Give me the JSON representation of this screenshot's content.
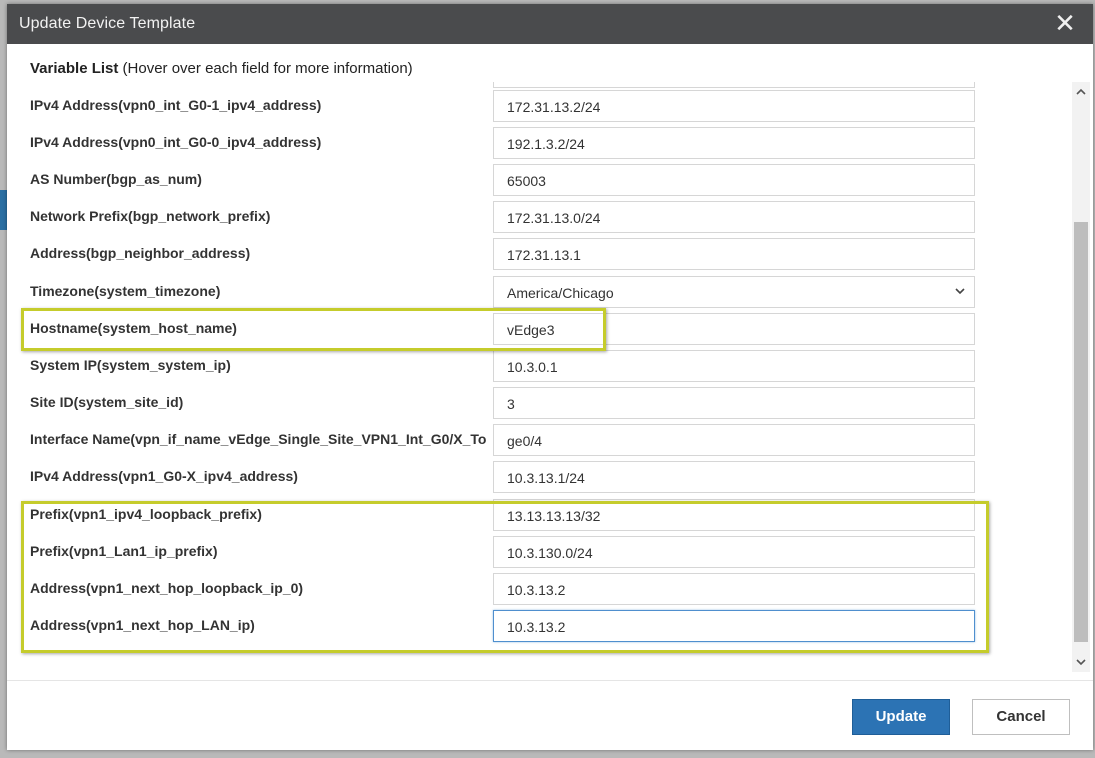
{
  "dialog": {
    "title": "Update Device Template",
    "close_glyph": "✕",
    "header_bold": "Variable List",
    "header_hint": " (Hover over each field for more information)"
  },
  "rows": [
    {
      "label": "IPv4 Address(vpn0_int_G0-1_ipv4_address)",
      "value": "172.31.13.2/24",
      "type": "text"
    },
    {
      "label": "IPv4 Address(vpn0_int_G0-0_ipv4_address)",
      "value": "192.1.3.2/24",
      "type": "text"
    },
    {
      "label": "AS Number(bgp_as_num)",
      "value": "65003",
      "type": "text"
    },
    {
      "label": "Network Prefix(bgp_network_prefix)",
      "value": "172.31.13.0/24",
      "type": "text"
    },
    {
      "label": "Address(bgp_neighbor_address)",
      "value": "172.31.13.1",
      "type": "text"
    },
    {
      "label": "Timezone(system_timezone)",
      "value": "America/Chicago",
      "type": "select"
    },
    {
      "label": "Hostname(system_host_name)",
      "value": "vEdge3",
      "type": "text"
    },
    {
      "label": "System IP(system_system_ip)",
      "value": "10.3.0.1",
      "type": "text"
    },
    {
      "label": "Site ID(system_site_id)",
      "value": "3",
      "type": "text"
    },
    {
      "label": "Interface Name(vpn_if_name_vEdge_Single_Site_VPN1_Int_G0/X_To",
      "value": "ge0/4",
      "type": "text"
    },
    {
      "label": "IPv4 Address(vpn1_G0-X_ipv4_address)",
      "value": "10.3.13.1/24",
      "type": "text"
    },
    {
      "label": "Prefix(vpn1_ipv4_loopback_prefix)",
      "value": "13.13.13.13/32",
      "type": "text"
    },
    {
      "label": "Prefix(vpn1_Lan1_ip_prefix)",
      "value": "10.3.130.0/24",
      "type": "text"
    },
    {
      "label": "Address(vpn1_next_hop_loopback_ip_0)",
      "value": "10.3.13.2",
      "type": "text"
    },
    {
      "label": "Address(vpn1_next_hop_LAN_ip)",
      "value": "10.3.13.2",
      "type": "text",
      "focused": true
    }
  ],
  "buttons": {
    "update": "Update",
    "cancel": "Cancel"
  },
  "colors": {
    "titlebar": "#4a4b4d",
    "highlight": "#c5cc2c",
    "primary": "#2c73b4"
  },
  "icons": {
    "close": "close-icon",
    "select": "chevron-down-icon",
    "scroll_up": "chevron-up-icon",
    "scroll_down": "chevron-down-icon"
  }
}
